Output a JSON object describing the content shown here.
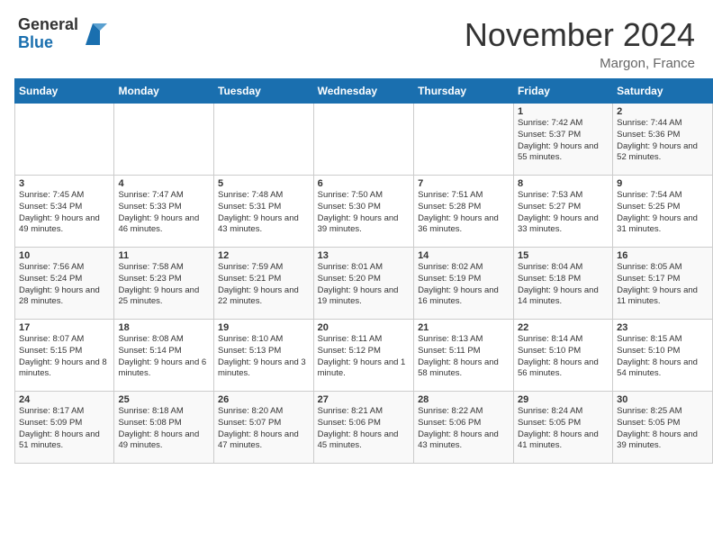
{
  "header": {
    "logo_general": "General",
    "logo_blue": "Blue",
    "month_title": "November 2024",
    "location": "Margon, France"
  },
  "calendar": {
    "days_of_week": [
      "Sunday",
      "Monday",
      "Tuesday",
      "Wednesday",
      "Thursday",
      "Friday",
      "Saturday"
    ],
    "weeks": [
      [
        {
          "day": "",
          "info": ""
        },
        {
          "day": "",
          "info": ""
        },
        {
          "day": "",
          "info": ""
        },
        {
          "day": "",
          "info": ""
        },
        {
          "day": "",
          "info": ""
        },
        {
          "day": "1",
          "info": "Sunrise: 7:42 AM\nSunset: 5:37 PM\nDaylight: 9 hours and 55 minutes."
        },
        {
          "day": "2",
          "info": "Sunrise: 7:44 AM\nSunset: 5:36 PM\nDaylight: 9 hours and 52 minutes."
        }
      ],
      [
        {
          "day": "3",
          "info": "Sunrise: 7:45 AM\nSunset: 5:34 PM\nDaylight: 9 hours and 49 minutes."
        },
        {
          "day": "4",
          "info": "Sunrise: 7:47 AM\nSunset: 5:33 PM\nDaylight: 9 hours and 46 minutes."
        },
        {
          "day": "5",
          "info": "Sunrise: 7:48 AM\nSunset: 5:31 PM\nDaylight: 9 hours and 43 minutes."
        },
        {
          "day": "6",
          "info": "Sunrise: 7:50 AM\nSunset: 5:30 PM\nDaylight: 9 hours and 39 minutes."
        },
        {
          "day": "7",
          "info": "Sunrise: 7:51 AM\nSunset: 5:28 PM\nDaylight: 9 hours and 36 minutes."
        },
        {
          "day": "8",
          "info": "Sunrise: 7:53 AM\nSunset: 5:27 PM\nDaylight: 9 hours and 33 minutes."
        },
        {
          "day": "9",
          "info": "Sunrise: 7:54 AM\nSunset: 5:25 PM\nDaylight: 9 hours and 31 minutes."
        }
      ],
      [
        {
          "day": "10",
          "info": "Sunrise: 7:56 AM\nSunset: 5:24 PM\nDaylight: 9 hours and 28 minutes."
        },
        {
          "day": "11",
          "info": "Sunrise: 7:58 AM\nSunset: 5:23 PM\nDaylight: 9 hours and 25 minutes."
        },
        {
          "day": "12",
          "info": "Sunrise: 7:59 AM\nSunset: 5:21 PM\nDaylight: 9 hours and 22 minutes."
        },
        {
          "day": "13",
          "info": "Sunrise: 8:01 AM\nSunset: 5:20 PM\nDaylight: 9 hours and 19 minutes."
        },
        {
          "day": "14",
          "info": "Sunrise: 8:02 AM\nSunset: 5:19 PM\nDaylight: 9 hours and 16 minutes."
        },
        {
          "day": "15",
          "info": "Sunrise: 8:04 AM\nSunset: 5:18 PM\nDaylight: 9 hours and 14 minutes."
        },
        {
          "day": "16",
          "info": "Sunrise: 8:05 AM\nSunset: 5:17 PM\nDaylight: 9 hours and 11 minutes."
        }
      ],
      [
        {
          "day": "17",
          "info": "Sunrise: 8:07 AM\nSunset: 5:15 PM\nDaylight: 9 hours and 8 minutes."
        },
        {
          "day": "18",
          "info": "Sunrise: 8:08 AM\nSunset: 5:14 PM\nDaylight: 9 hours and 6 minutes."
        },
        {
          "day": "19",
          "info": "Sunrise: 8:10 AM\nSunset: 5:13 PM\nDaylight: 9 hours and 3 minutes."
        },
        {
          "day": "20",
          "info": "Sunrise: 8:11 AM\nSunset: 5:12 PM\nDaylight: 9 hours and 1 minute."
        },
        {
          "day": "21",
          "info": "Sunrise: 8:13 AM\nSunset: 5:11 PM\nDaylight: 8 hours and 58 minutes."
        },
        {
          "day": "22",
          "info": "Sunrise: 8:14 AM\nSunset: 5:10 PM\nDaylight: 8 hours and 56 minutes."
        },
        {
          "day": "23",
          "info": "Sunrise: 8:15 AM\nSunset: 5:10 PM\nDaylight: 8 hours and 54 minutes."
        }
      ],
      [
        {
          "day": "24",
          "info": "Sunrise: 8:17 AM\nSunset: 5:09 PM\nDaylight: 8 hours and 51 minutes."
        },
        {
          "day": "25",
          "info": "Sunrise: 8:18 AM\nSunset: 5:08 PM\nDaylight: 8 hours and 49 minutes."
        },
        {
          "day": "26",
          "info": "Sunrise: 8:20 AM\nSunset: 5:07 PM\nDaylight: 8 hours and 47 minutes."
        },
        {
          "day": "27",
          "info": "Sunrise: 8:21 AM\nSunset: 5:06 PM\nDaylight: 8 hours and 45 minutes."
        },
        {
          "day": "28",
          "info": "Sunrise: 8:22 AM\nSunset: 5:06 PM\nDaylight: 8 hours and 43 minutes."
        },
        {
          "day": "29",
          "info": "Sunrise: 8:24 AM\nSunset: 5:05 PM\nDaylight: 8 hours and 41 minutes."
        },
        {
          "day": "30",
          "info": "Sunrise: 8:25 AM\nSunset: 5:05 PM\nDaylight: 8 hours and 39 minutes."
        }
      ]
    ]
  }
}
